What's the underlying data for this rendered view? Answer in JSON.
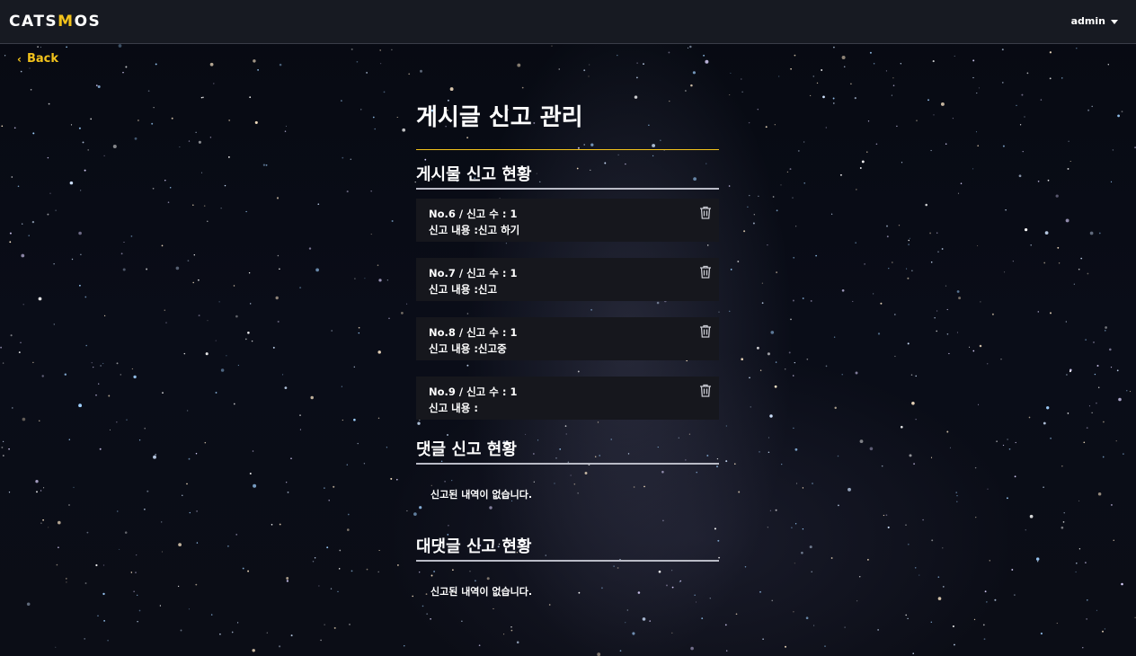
{
  "header": {
    "logo": {
      "pre": "CATS",
      "mid": "M",
      "post": "OS"
    },
    "user": "admin"
  },
  "nav": {
    "back_label": "Back"
  },
  "page": {
    "title": "게시글 신고 관리"
  },
  "post_reports": {
    "heading": "게시물 신고 현황",
    "items": [
      {
        "line1": "No.6 / 신고 수 : 1",
        "line2": "신고 내용 :신고 하기"
      },
      {
        "line1": "No.7 / 신고 수 : 1",
        "line2": "신고 내용 :신고"
      },
      {
        "line1": "No.8 / 신고 수 : 1",
        "line2": "신고 내용 :신고중"
      },
      {
        "line1": "No.9 / 신고 수 : 1",
        "line2": "신고 내용 :"
      }
    ]
  },
  "comment_reports": {
    "heading": "댓글 신고 현황",
    "empty_text": "신고된 내역이 없습니다."
  },
  "reply_reports": {
    "heading": "대댓글 신고 현황",
    "empty_text": "신고된 내역이 없습니다."
  },
  "icons": {
    "delete": "trash-icon",
    "back": "chevron-left-icon",
    "menu": "caret-down-icon"
  },
  "colors": {
    "accent": "#f2c21b",
    "header_bg": "#171a22",
    "card_bg": "#16171d"
  }
}
